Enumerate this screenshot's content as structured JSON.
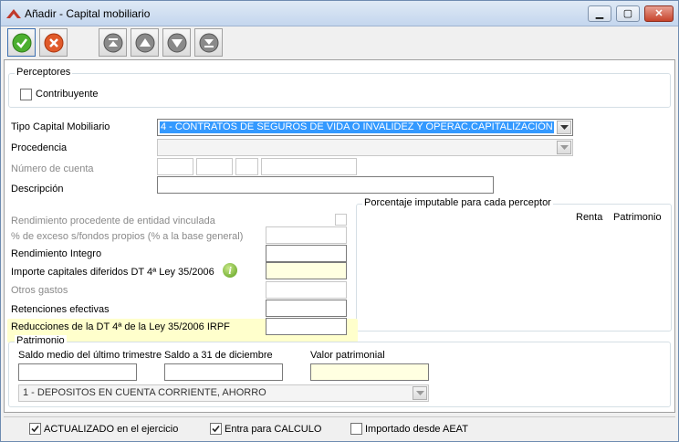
{
  "window": {
    "title": "Añadir  - Capital mobiliario",
    "minimize": "▁",
    "maximize": "▢",
    "close": "✕"
  },
  "toolbar": {
    "accept_icon": "check-icon",
    "cancel_icon": "cancel-icon",
    "nav": [
      "first-icon",
      "previous-icon",
      "next-icon",
      "last-icon"
    ]
  },
  "perceptores": {
    "title": "Perceptores",
    "contribuyente": "Contribuyente"
  },
  "form": {
    "tipo_label": "Tipo Capital Mobiliario",
    "tipo_value": "4 - CONTRATOS DE SEGUROS DE VIDA O INVALIDEZ Y OPERAC.CAPITALIZACIÓN",
    "procedencia_label": "Procedencia",
    "procedencia_value": "",
    "numero_cuenta_label": "Número de cuenta",
    "descripcion_label": "Descripción",
    "descripcion_value": "",
    "rend_entidad_label": "Rendimiento procedente de entidad vinculada",
    "exceso_label": "% de exceso s/fondos propios (% a la base general)",
    "rend_integro_label": "Rendimiento Integro",
    "importe_label": "Importe capitales diferidos DT  4ª Ley 35/2006",
    "otros_gastos_label": "Otros gastos",
    "retenciones_label": "Retenciones efectivas",
    "reducciones_label": "Reducciones de la DT 4ª de la Ley 35/2006 IRPF"
  },
  "porcentaje": {
    "title": "Porcentaje imputable para cada perceptor",
    "col_renta": "Renta",
    "col_patrimonio": "Patrimonio"
  },
  "patrimonio": {
    "title": "Patrimonio",
    "saldo_medio_label": "Saldo medio del último trimestre",
    "saldo_31_label": "Saldo a 31 de diciembre",
    "valor_label": "Valor patrimonial",
    "tipo_value": "1 - DEPOSITOS EN CUENTA CORRIENTE, AHORRO"
  },
  "status": {
    "actualizado": "ACTUALIZADO en el ejercicio",
    "actualizado_checked": true,
    "entra": "Entra para CALCULO",
    "entra_checked": true,
    "importado": "Importado desde AEAT",
    "importado_checked": false
  },
  "colors": {
    "accent": "#3399ff",
    "highlight": "#ffffcc"
  }
}
